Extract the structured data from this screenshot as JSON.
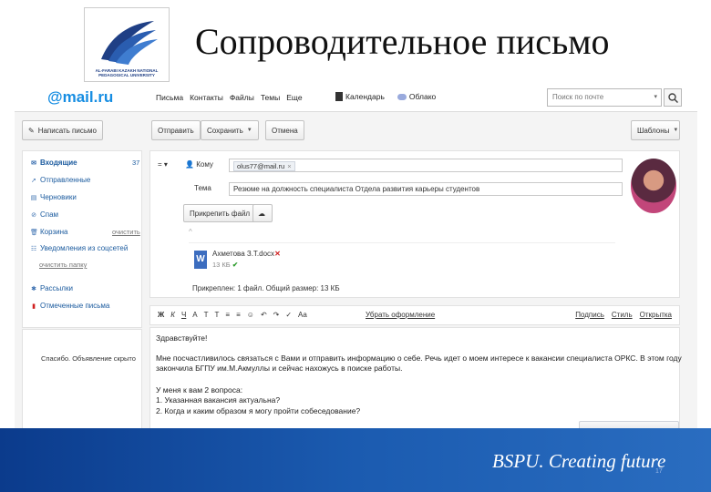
{
  "slide": {
    "title": "Сопроводительное письмо",
    "logo_text": "AL-FARABI KAZAKH NATIONAL PEDAGOGICAL UNIVERSITY",
    "footer_text": "BSPU. Creating future",
    "slide_number": "17"
  },
  "header": {
    "logo": "@mail.ru",
    "nav": [
      "Письма",
      "Контакты",
      "Файлы",
      "Темы",
      "Еще"
    ],
    "apps": [
      "Календарь",
      "Облако"
    ],
    "search_placeholder": "Поиск по почте"
  },
  "toolbar": {
    "compose": "Написать письмо",
    "send": "Отправить",
    "save": "Сохранить",
    "cancel": "Отмена",
    "templates": "Шаблоны"
  },
  "sidebar": {
    "folders": [
      {
        "label": "Входящие",
        "count": "37",
        "icon": "inbox-icon"
      },
      {
        "label": "Отправленные",
        "icon": "sent-icon"
      },
      {
        "label": "Черновики",
        "icon": "drafts-icon"
      },
      {
        "label": "Спам",
        "icon": "spam-icon"
      },
      {
        "label": "Корзина",
        "icon": "trash-icon"
      },
      {
        "label": "Рассылки",
        "icon": "mailing-icon"
      },
      {
        "label": "Отмеченные письма",
        "icon": "flag-icon"
      }
    ],
    "clear_label": "очистить",
    "social_folder": "Уведомления из соцсетей",
    "clear_label_2": "очистить папку",
    "ad_text": "Спасибо. Объявление скрыто"
  },
  "compose": {
    "to_label": "Кому",
    "to_chip": "olus77@mail.ru",
    "subject_label": "Тема",
    "subject": "Резюме на должность специалиста Отдела развития карьеры студентов",
    "attach_button": "Прикрепить файл",
    "attachment_name": "Ахметова З.Т.docx",
    "attachment_size": "13 КБ",
    "attach_summary": "Прикреплен: 1 файл. Общий размер: 13 КБ"
  },
  "format": {
    "tools": [
      "Ж",
      "К",
      "Ч",
      "А",
      "Т",
      "Т",
      "≡",
      "≡",
      "☺",
      "↶",
      "↷",
      "✓",
      "Aa"
    ],
    "remove": "Убрать оформление",
    "right": [
      "Подпись",
      "Стиль",
      "Открытка"
    ]
  },
  "body": {
    "lines": [
      "Здравствуйте!",
      "Мне посчастливилось связаться с Вами и отправить информацию о себе. Речь идет о моем интересе к вакансии специалиста ОРКС. В этом году",
      "закончила БГПУ им.М.Акмуллы и сейчас нахожусь в поиске работы.",
      "У меня к вам 2 вопроса:",
      "1. Указанная вакансия актуальна?",
      "2. Когда и каким образом я могу пройти собеседование?"
    ]
  },
  "colors": {
    "brand_blue": "#168de2",
    "footer_blue": "#1b5bb0"
  }
}
